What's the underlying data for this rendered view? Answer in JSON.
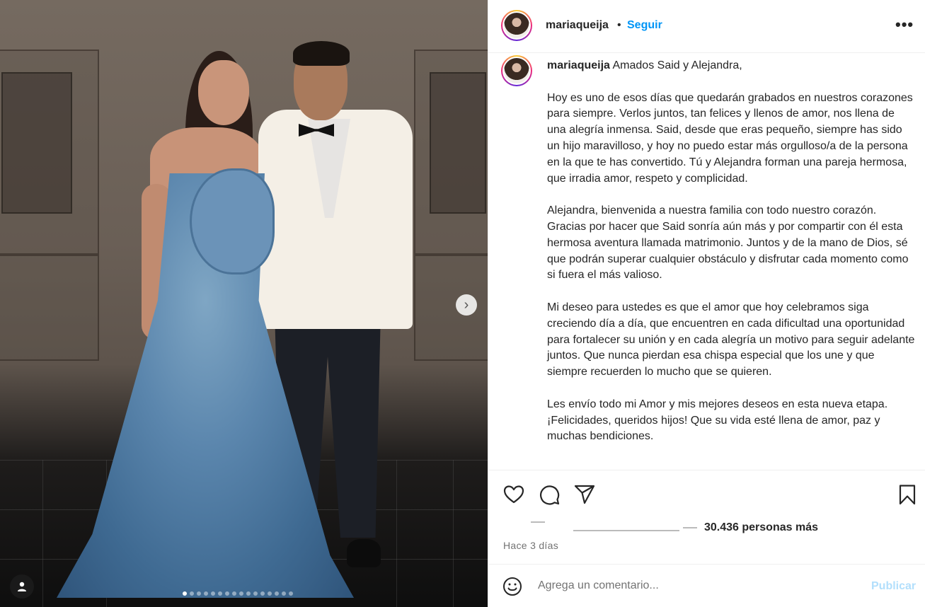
{
  "photo": {
    "next_glyph": "›",
    "slide_count": 16,
    "active_slide": 1
  },
  "post": {
    "username": "mariaqueija",
    "separator": "•",
    "follow_label": "Seguir",
    "more_label": "•••",
    "caption": {
      "username": "mariaqueija",
      "greeting": "Amados Said y Alejandra,",
      "paragraphs": [
        "Hoy es uno de esos días que quedarán grabados en nuestros corazones para siempre. Verlos juntos, tan felices y llenos de amor, nos llena de una alegría inmensa. Said, desde que eras pequeño, siempre has sido un hijo maravilloso, y hoy no puedo estar más orgulloso/a de la persona en la que te has convertido. Tú y Alejandra forman una pareja hermosa, que irradia amor, respeto y complicidad.",
        "Alejandra, bienvenida a nuestra familia con todo nuestro corazón. Gracias por hacer que Said sonría aún más y por compartir con él esta hermosa aventura llamada matrimonio. Juntos y de la mano de Dios, sé que podrán superar cualquier obstáculo y disfrutar cada momento como si fuera el más valioso.",
        "Mi deseo para ustedes es que el amor que hoy celebramos siga creciendo día a día, que encuentren en cada dificultad una oportunidad para fortalecer su unión y en cada alegría un motivo para seguir adelante juntos. Que nunca pierdan esa chispa especial que los une y que siempre recuerden lo mucho que se quieren.",
        "Les envío todo mi Amor y mis mejores deseos en esta nueva etapa. ¡Felicidades, queridos hijos! Que su vida esté llena de amor, paz y muchas bendiciones."
      ]
    },
    "likes_text": "30.436 personas más",
    "time_ago": "Hace 3 días",
    "comment_placeholder": "Agrega un comentario...",
    "publish_label": "Publicar"
  },
  "icons": {
    "like": "heart-icon",
    "comment": "comment-icon",
    "share": "send-icon",
    "save": "bookmark-icon",
    "emoji": "emoji-icon",
    "tag": "user-tag-icon",
    "next": "chevron-right-icon"
  },
  "colors": {
    "accent": "#0095f6",
    "publish_disabled": "#b2dffc",
    "text": "#262626",
    "muted": "#737373",
    "divider": "#efefef"
  }
}
